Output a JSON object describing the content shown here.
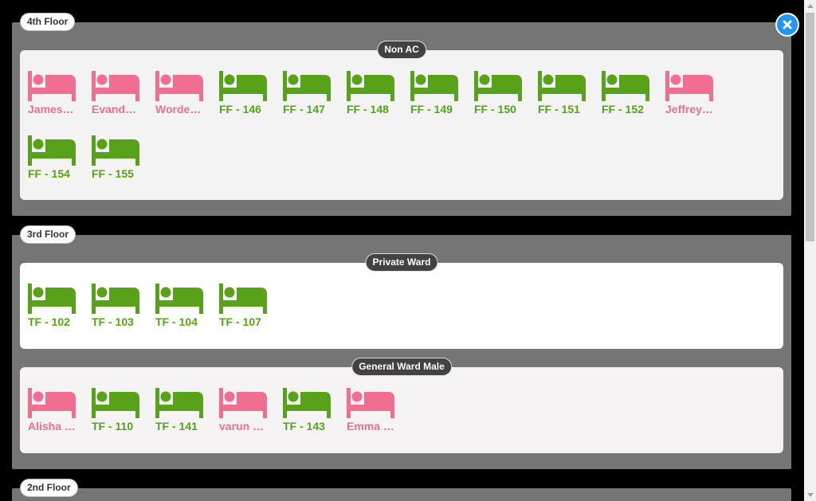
{
  "colors": {
    "free": "#58a21a",
    "occupied": "#f06e8f"
  },
  "close_icon": "close-icon",
  "floors": [
    {
      "name": "4th Floor",
      "wards": [
        {
          "name": "Non AC",
          "beds": [
            {
              "label": "Jamesh…",
              "status": "occupied"
            },
            {
              "label": "Evander…",
              "status": "occupied"
            },
            {
              "label": "Wordey …",
              "status": "occupied"
            },
            {
              "label": "FF - 146",
              "status": "free"
            },
            {
              "label": "FF - 147",
              "status": "free"
            },
            {
              "label": "FF - 148",
              "status": "free"
            },
            {
              "label": "FF - 149",
              "status": "free"
            },
            {
              "label": "FF - 150",
              "status": "free"
            },
            {
              "label": "FF - 151",
              "status": "free"
            },
            {
              "label": "FF - 152",
              "status": "free"
            },
            {
              "label": "Jeffrey …",
              "status": "occupied"
            },
            {
              "label": "FF - 154",
              "status": "free"
            },
            {
              "label": "FF - 155",
              "status": "free"
            }
          ]
        }
      ]
    },
    {
      "name": "3rd Floor",
      "wards": [
        {
          "name": "Private Ward",
          "beds": [
            {
              "label": "TF - 102",
              "status": "free"
            },
            {
              "label": "TF - 103",
              "status": "free"
            },
            {
              "label": "TF - 104",
              "status": "free"
            },
            {
              "label": "TF - 107",
              "status": "free"
            }
          ]
        },
        {
          "name": "General Ward Male",
          "beds": [
            {
              "label": "Alisha K…",
              "status": "occupied"
            },
            {
              "label": "TF - 110",
              "status": "free"
            },
            {
              "label": "TF - 141",
              "status": "free"
            },
            {
              "label": "varun m…",
              "status": "occupied"
            },
            {
              "label": "TF - 143",
              "status": "free"
            },
            {
              "label": "Emma …",
              "status": "occupied"
            }
          ]
        }
      ]
    },
    {
      "name": "2nd Floor",
      "wards": []
    }
  ]
}
